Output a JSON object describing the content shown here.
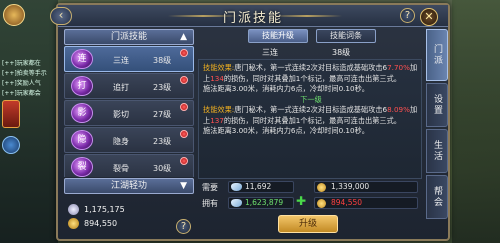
{
  "window": {
    "title": "门派技能",
    "back_glyph": "‹",
    "close_glyph": "✕",
    "help_glyph": "?"
  },
  "left_panel": {
    "section_header": "门派技能",
    "section_arrow": "▲",
    "skills": [
      {
        "icon_text": "连",
        "name": "三连",
        "level": "38级",
        "selected": true,
        "has_dot": true
      },
      {
        "icon_text": "打",
        "name": "追打",
        "level": "23级",
        "selected": false,
        "has_dot": true
      },
      {
        "icon_text": "影",
        "name": "影切",
        "level": "27级",
        "selected": false,
        "has_dot": true
      },
      {
        "icon_text": "隐",
        "name": "隐身",
        "level": "23级",
        "selected": false,
        "has_dot": true
      },
      {
        "icon_text": "裂",
        "name": "裂骨",
        "level": "30级",
        "selected": false,
        "has_dot": true
      }
    ],
    "second_header": "江湖轻功",
    "second_arrow": "▼",
    "resources": [
      {
        "icon": "silver-coin-icon",
        "value": "1,175,175",
        "color": "#d8d8f0"
      },
      {
        "icon": "gold-coin-icon",
        "value": "894,550",
        "color": "#f0c050"
      }
    ]
  },
  "tabs": [
    {
      "label": "技能升级",
      "active": true
    },
    {
      "label": "技能词条",
      "active": false
    }
  ],
  "skill_info": {
    "name": "三连",
    "level": "38级"
  },
  "description": {
    "current_label": "技能效果:",
    "current_text_a": "唐门秘术，第一式连续2次对目标造成基础攻击6",
    "current_hl_a": "7.70%",
    "current_text_b": "加上",
    "current_hl_b": "134",
    "current_text_c": "的损伤，同时对其叠加1个标记，最高可连击出第三式。",
    "current_cost": "施法距离3.00米，消耗内力6点，冷却时间0.10秒。",
    "next_separator": "下一级",
    "next_label": "技能效果:",
    "next_text_a": "唐门秘术，第一式连续2次对目标造成基础攻击6",
    "next_hl_a": "8.09%",
    "next_text_b": "加上",
    "next_hl_b": "137",
    "next_text_c": "的损伤，同时对其叠加1个标记，最高可连击出第三式。",
    "next_cost": "施法距离3.00米，消耗内力6点，冷却时间0.10秒。"
  },
  "costs": {
    "need_label": "需要",
    "have_label": "拥有",
    "need_gem": "11,692",
    "need_coin": "1,339,000",
    "have_gem": "1,623,879",
    "have_coin": "894,550",
    "plus_glyph": "✚"
  },
  "upgrade_button": "升级",
  "side_tabs": [
    {
      "label": "门派",
      "active": true
    },
    {
      "label": "设置",
      "active": false
    },
    {
      "label": "生活",
      "active": false
    },
    {
      "label": "帮会",
      "active": false
    }
  ],
  "background_text": {
    "line1": "[++]玩家都在",
    "line2": "[++]拍卖等手示",
    "line3": "[++]奖励人气",
    "line4": "[++]玩家都会"
  },
  "colors": {
    "accent": "#8aa0c8",
    "highlight_red": "#ff5050",
    "label_gold": "#f0b020",
    "next_green": "#6ee06e",
    "upgrade_gold": "#f2c66a"
  }
}
